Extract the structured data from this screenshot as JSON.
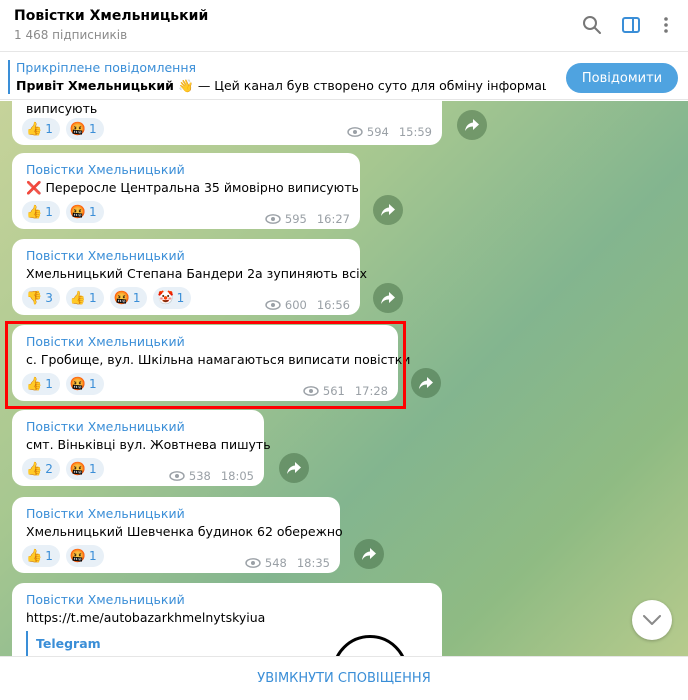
{
  "header": {
    "title": "Повістки Хмельницький",
    "subscribers": "1 468 підписників"
  },
  "pinned": {
    "label": "Прикріплене повідомлення",
    "bold": "Привіт Хмельницький 👋",
    "rest": " — Цей канал був створено суто для обміну інформаціє..."
  },
  "actions": {
    "message_button": "Повідомити"
  },
  "messages": [
    {
      "text": "виписують",
      "reactions": [
        {
          "emoji": "👍",
          "count": "1"
        },
        {
          "emoji": "🤬",
          "count": "1"
        }
      ],
      "views": "594",
      "time": "15:59"
    },
    {
      "author": "Повістки Хмельницький",
      "text": "❌ Переросле Центральна 35 ймовірно виписують",
      "reactions": [
        {
          "emoji": "👍",
          "count": "1"
        },
        {
          "emoji": "🤬",
          "count": "1"
        }
      ],
      "views": "595",
      "time": "16:27"
    },
    {
      "author": "Повістки Хмельницький",
      "text": "Хмельницький Степана Бандери 2а зупиняють всіх",
      "reactions": [
        {
          "emoji": "👎",
          "count": "3"
        },
        {
          "emoji": "👍",
          "count": "1"
        },
        {
          "emoji": "🤬",
          "count": "1"
        },
        {
          "emoji": "🤡",
          "count": "1"
        }
      ],
      "views": "600",
      "time": "16:56"
    },
    {
      "author": "Повістки Хмельницький",
      "text": "с. Гробище, вул. Шкільна намагаються виписати повістки",
      "reactions": [
        {
          "emoji": "👍",
          "count": "1"
        },
        {
          "emoji": "🤬",
          "count": "1"
        }
      ],
      "views": "561",
      "time": "17:28"
    },
    {
      "author": "Повістки Хмельницький",
      "text": "смт. Віньківці вул. Жовтнева пишуть",
      "reactions": [
        {
          "emoji": "👍",
          "count": "2"
        },
        {
          "emoji": "🤬",
          "count": "1"
        }
      ],
      "views": "538",
      "time": "18:05"
    },
    {
      "author": "Повістки Хмельницький",
      "text": "Хмельницький Шевченка будинок 62 обережно",
      "reactions": [
        {
          "emoji": "👍",
          "count": "1"
        },
        {
          "emoji": "🤬",
          "count": "1"
        }
      ],
      "views": "548",
      "time": "18:35"
    },
    {
      "author": "Повістки Хмельницький",
      "link": "https://t.me/autobazarkhmelnytskyiua",
      "preview_title": "Telegram"
    }
  ],
  "footer": {
    "unmute": "УВІМКНУТИ СПОВІЩЕННЯ"
  }
}
